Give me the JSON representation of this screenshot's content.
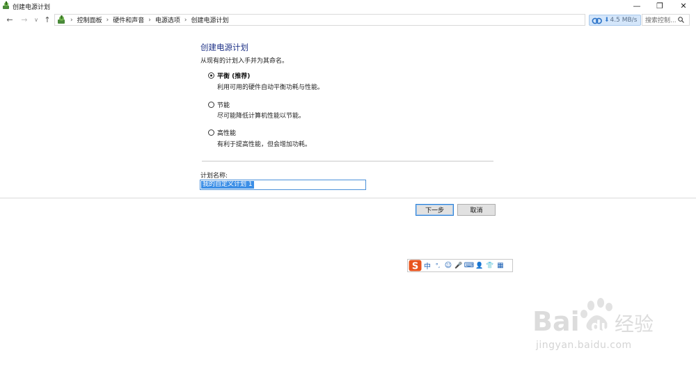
{
  "window": {
    "title": "创建电源计划",
    "minimize_glyph": "—",
    "restore_glyph": "❐",
    "close_glyph": "✕"
  },
  "nav": {
    "back_glyph": "←",
    "forward_glyph": "→",
    "history_glyph": "∨",
    "up_glyph": "↑"
  },
  "breadcrumb": {
    "separator": "›",
    "items": [
      "控制面板",
      "硬件和声音",
      "电源选项",
      "创建电源计划"
    ]
  },
  "netspeed": {
    "arrow": "⬇",
    "value": "4.5 MB/s"
  },
  "search": {
    "placeholder": "搜索控制..."
  },
  "main": {
    "heading": "创建电源计划",
    "subheading": "从现有的计划入手并为其命名。",
    "options": [
      {
        "label": "平衡 (推荐)",
        "description": "利用可用的硬件自动平衡功耗与性能。",
        "selected": true
      },
      {
        "label": "节能",
        "description": "尽可能降低计算机性能以节能。",
        "selected": false
      },
      {
        "label": "高性能",
        "description": "有利于提高性能，但会增加功耗。",
        "selected": false
      }
    ],
    "plan_name_label": "计划名称:",
    "plan_name_value": "我的自定义计划 1"
  },
  "buttons": {
    "next": "下一步",
    "cancel": "取消"
  },
  "ime": {
    "logo_letter": "S",
    "items": [
      "中",
      "°,",
      "☺",
      "🎤",
      "⌨",
      "👤",
      "👕",
      "▦"
    ]
  },
  "watermark": {
    "brand_a": "Bai",
    "brand_b": "du",
    "brand_cn": "经验",
    "url": "jingyan.baidu.com"
  },
  "colors": {
    "heading_blue": "#1e3287",
    "selection_blue": "#3b8ee6",
    "focus_border": "#2e7fd3",
    "ime_brand": "#e8541e"
  }
}
